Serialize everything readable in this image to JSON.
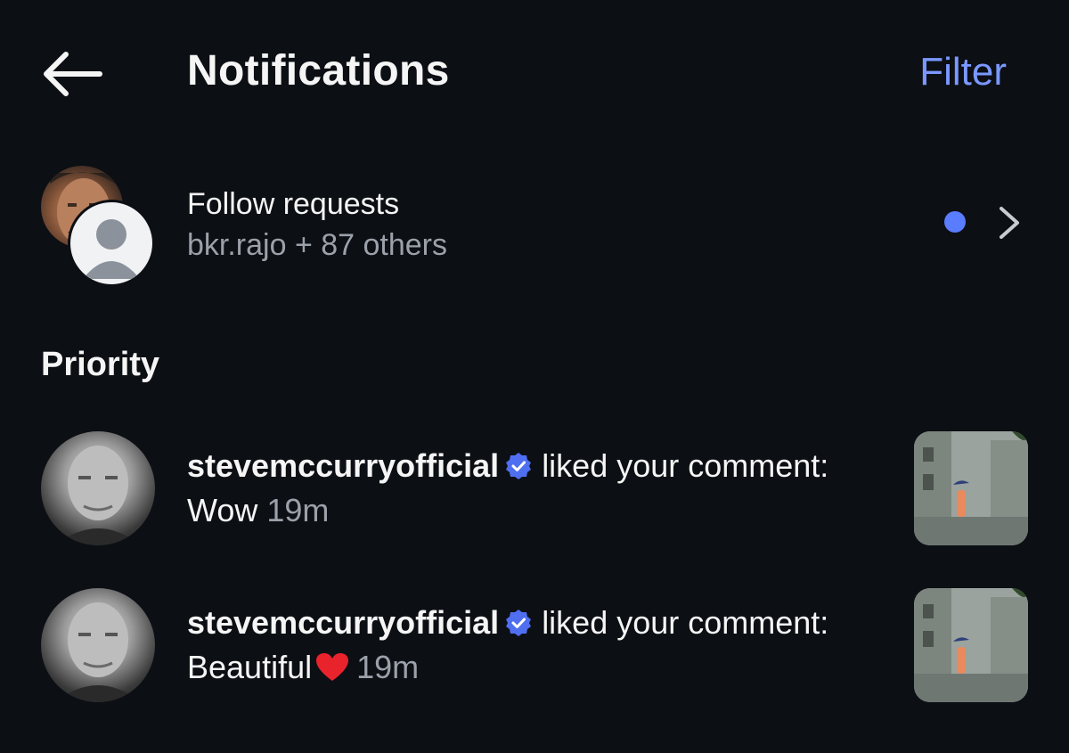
{
  "header": {
    "title": "Notifications",
    "filter_label": "Filter"
  },
  "follow_requests": {
    "title": "Follow requests",
    "subtitle": "bkr.rajo + 87 others"
  },
  "section_title": "Priority",
  "notifications": [
    {
      "username": "stevemccurryofficial",
      "action": "liked your comment:",
      "comment": "Wow",
      "time": "19m"
    },
    {
      "username": "stevemccurryofficial",
      "action": "liked your comment:",
      "comment": "Beautiful",
      "time": "19m"
    }
  ],
  "colors": {
    "background": "#0c0f14",
    "accent": "#7a98ff",
    "dot": "#5a7cff",
    "verified": "#4f6ff0",
    "muted": "#9ba1aa"
  },
  "icons": {
    "back": "arrow-left-icon",
    "chevron": "chevron-right-icon",
    "verified": "verified-badge-icon",
    "heart": "heart-emoji-icon"
  }
}
